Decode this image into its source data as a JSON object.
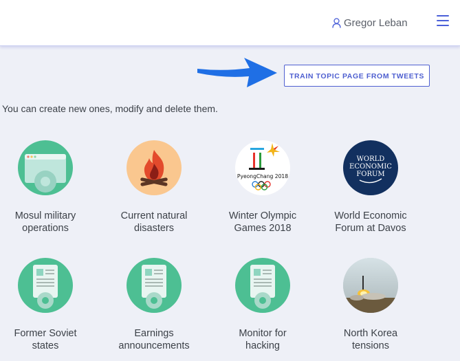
{
  "header": {
    "user_name": "Gregor Leban",
    "user_icon": "user-icon",
    "menu_icon": "hamburger-menu-icon"
  },
  "train_button": {
    "label": "TRAIN TOPIC PAGE FROM TWEETS"
  },
  "intro_text": "You can create new ones, modify and delete them.",
  "colors": {
    "accent": "#4e5fd0",
    "arrow": "#1f6fe5",
    "topic_green": "#4dbf93",
    "fire_bg": "#fac78f",
    "davos_bg": "#12305f"
  },
  "topics": [
    {
      "line1": "Mosul military",
      "line2": "operations",
      "icon": "browser-gear-icon"
    },
    {
      "line1": "Current natural",
      "line2": "disasters",
      "icon": "fire-icon"
    },
    {
      "line1": "Winter Olympic",
      "line2": "Games 2018",
      "icon": "pyeongchang-logo",
      "logo_text": "PyeongChang 2018"
    },
    {
      "line1": "World Economic",
      "line2": "Forum at Davos",
      "icon": "wef-logo",
      "logo_lines": [
        "WORLD",
        "ECONOMIC",
        "FORUM"
      ]
    },
    {
      "line1": "Former Soviet",
      "line2": "states",
      "icon": "document-gear-icon"
    },
    {
      "line1": "Earnings",
      "line2": "announcements",
      "icon": "document-gear-icon"
    },
    {
      "line1": "Monitor for",
      "line2": "hacking",
      "icon": "document-gear-icon"
    },
    {
      "line1": "North Korea",
      "line2": "tensions",
      "icon": "missile-launch-photo"
    }
  ]
}
